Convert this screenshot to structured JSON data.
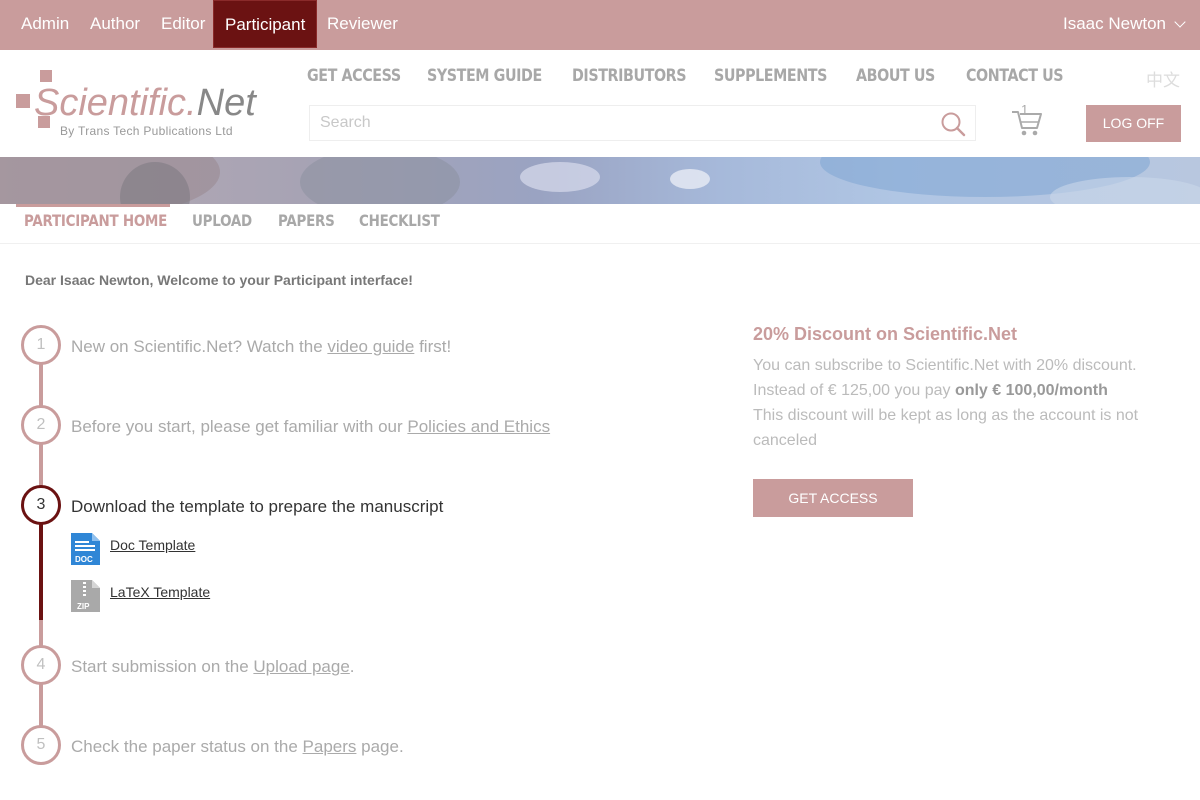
{
  "rolebar": {
    "roles": [
      "Admin",
      "Author",
      "Editor",
      "Participant",
      "Reviewer"
    ],
    "active_role": "Participant",
    "user_name": "Isaac Newton"
  },
  "logo": {
    "brand_main": "Scientific.",
    "brand_net": "Net",
    "tagline": "By Trans Tech Publications Ltd"
  },
  "mainnav": {
    "items": [
      "GET ACCESS",
      "SYSTEM GUIDE",
      "DISTRIBUTORS",
      "SUPPLEMENTS",
      "ABOUT US",
      "CONTACT US"
    ],
    "language": "中文"
  },
  "search": {
    "placeholder": "Search"
  },
  "cart": {
    "count": "1"
  },
  "logoff_label": "LOG OFF",
  "subnav": {
    "tabs": [
      "PARTICIPANT HOME",
      "UPLOAD",
      "PAPERS",
      "CHECKLIST"
    ],
    "active": "PARTICIPANT HOME"
  },
  "welcome": "Dear Isaac Newton, Welcome to your Participant interface!",
  "steps": [
    {
      "num": "1",
      "before": "New on Scientific.Net? Watch the ",
      "link": "video guide",
      "after": " first!"
    },
    {
      "num": "2",
      "before": "Before you start, please get familiar with our ",
      "link": "Policies and Ethics",
      "after": ""
    },
    {
      "num": "3",
      "text": "Download the template to prepare the manuscript"
    },
    {
      "num": "4",
      "before": "Start submission on the ",
      "link": "Upload page",
      "after": "."
    },
    {
      "num": "5",
      "before": "Check the paper status on the ",
      "link": "Papers",
      "after": " page."
    }
  ],
  "templates": [
    {
      "label": "Doc Template",
      "icon_text": "DOC",
      "icon": "doc-file-icon",
      "color": "#2f86d6"
    },
    {
      "label": "LaTeX Template",
      "icon_text": "ZIP",
      "icon": "zip-file-icon",
      "color": "#a9a9a9"
    }
  ],
  "promo": {
    "title": "20% Discount on Scientific.Net",
    "line1": "You can subscribe to Scientific.Net with 20% discount.",
    "line2_before": "Instead of € 125,00 you pay ",
    "line2_bold": "only € 100,00/month",
    "line3": "This discount will be kept as long as the account is not",
    "line4": "canceled",
    "button": "GET ACCESS"
  },
  "colors": {
    "accent": "#c99c9c",
    "dark_accent": "#6b1212"
  }
}
